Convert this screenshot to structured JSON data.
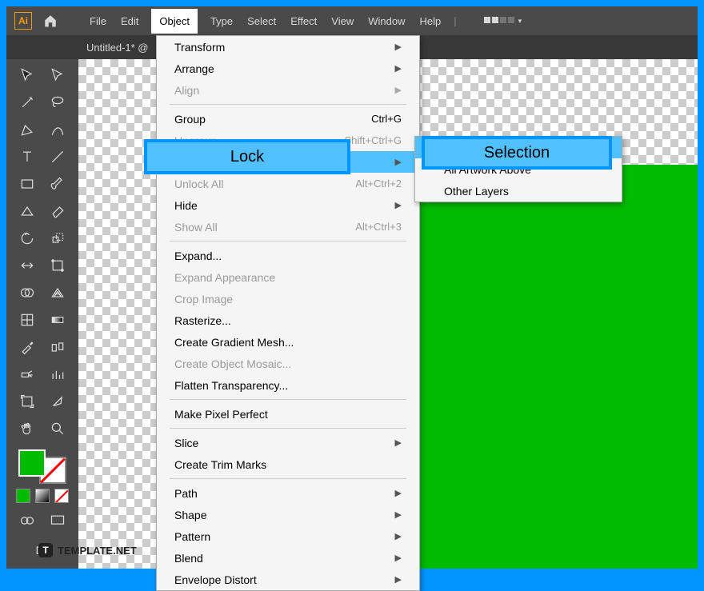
{
  "app": {
    "name": "Ai"
  },
  "menubar": [
    "File",
    "Edit",
    "Object",
    "Type",
    "Select",
    "Effect",
    "View",
    "Window",
    "Help"
  ],
  "activeMenu": "Object",
  "tab": {
    "label": "Untitled-1* @"
  },
  "dropdown": {
    "items": [
      {
        "label": "Transform",
        "type": "sub"
      },
      {
        "label": "Arrange",
        "type": "sub"
      },
      {
        "label": "Align",
        "type": "sub",
        "disabled": true
      },
      {
        "type": "sep"
      },
      {
        "label": "Group",
        "shortcut": "Ctrl+G"
      },
      {
        "label": "Ungroup",
        "shortcut": "Shift+Ctrl+G",
        "disabled": true
      },
      {
        "label": "Lock",
        "type": "sub",
        "highlighted": true
      },
      {
        "label": "Unlock All",
        "shortcut": "Alt+Ctrl+2",
        "disabled": true
      },
      {
        "label": "Hide",
        "type": "sub"
      },
      {
        "label": "Show All",
        "shortcut": "Alt+Ctrl+3",
        "disabled": true
      },
      {
        "type": "sep"
      },
      {
        "label": "Expand..."
      },
      {
        "label": "Expand Appearance",
        "disabled": true
      },
      {
        "label": "Crop Image",
        "disabled": true
      },
      {
        "label": "Rasterize..."
      },
      {
        "label": "Create Gradient Mesh..."
      },
      {
        "label": "Create Object Mosaic...",
        "disabled": true
      },
      {
        "label": "Flatten Transparency..."
      },
      {
        "type": "sep"
      },
      {
        "label": "Make Pixel Perfect"
      },
      {
        "type": "sep"
      },
      {
        "label": "Slice",
        "type": "sub"
      },
      {
        "label": "Create Trim Marks"
      },
      {
        "type": "sep"
      },
      {
        "label": "Path",
        "type": "sub"
      },
      {
        "label": "Shape",
        "type": "sub"
      },
      {
        "label": "Pattern",
        "type": "sub"
      },
      {
        "label": "Blend",
        "type": "sub"
      },
      {
        "label": "Envelope Distort",
        "type": "sub"
      }
    ]
  },
  "submenu": {
    "items": [
      {
        "label": "Selection",
        "highlighted": true
      },
      {
        "label": "All Artwork Above"
      },
      {
        "label": "Other Layers"
      }
    ]
  },
  "highlights": {
    "lock": "Lock",
    "selection": "Selection"
  },
  "watermark": {
    "badge": "T",
    "text": "TEMPLATE.NET"
  }
}
